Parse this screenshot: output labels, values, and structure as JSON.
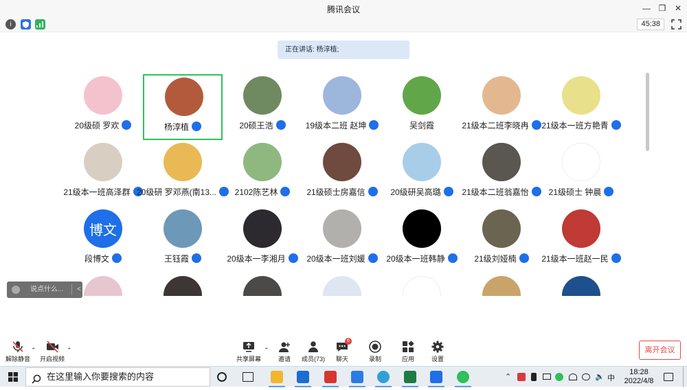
{
  "window": {
    "title": "腾讯会议",
    "timer": "45:38",
    "speaking": "正在讲话: 杨淳植;"
  },
  "participants": [
    {
      "name": "20级硕 罗欢",
      "color": "#f4c2cc",
      "active": false
    },
    {
      "name": "杨淳植",
      "color": "#b45a3c",
      "active": true
    },
    {
      "name": "20硕王浩",
      "color": "#6f8a61",
      "active": false
    },
    {
      "name": "19级本二班 赵坤",
      "color": "#9db6dc",
      "active": false
    },
    {
      "name": "吴剑霞",
      "color": "#62a64a",
      "active": false
    },
    {
      "name": "21级本二班李晓冉",
      "color": "#e3b890",
      "active": false
    },
    {
      "name": "21级本一班方艳青",
      "color": "#e8e08a",
      "active": false
    },
    {
      "name": "21级本一班高泽群",
      "color": "#d8cfc2",
      "active": false
    },
    {
      "name": "20级研 罗邓燕(南13...",
      "color": "#e9b955",
      "active": false
    },
    {
      "name": "2102陈艺林",
      "color": "#8fb880",
      "active": false
    },
    {
      "name": "21级硕士房嘉信",
      "color": "#6e4b3e",
      "active": false
    },
    {
      "name": "20级研吴高璐",
      "color": "#a8cde8",
      "active": false
    },
    {
      "name": "21级本二班翁嘉怡",
      "color": "#5a5650",
      "active": false
    },
    {
      "name": "21级硕士 钟晨",
      "color": "#ffffff",
      "active": false
    },
    {
      "name": "段博文",
      "color": "#1e6fe8",
      "text": "博文",
      "active": false
    },
    {
      "name": "王钰霞",
      "color": "#6e98b8",
      "active": false
    },
    {
      "name": "20级本一李湘月",
      "color": "#2c2a2e",
      "active": false
    },
    {
      "name": "20级本一班刘媛",
      "color": "#b2b0ac",
      "active": false
    },
    {
      "name": "20级本一班韩静",
      "color": "#000000",
      "active": false
    },
    {
      "name": "21级刘娅楠",
      "color": "#6b6450",
      "active": false
    },
    {
      "name": "21级本一班赵一民",
      "color": "#c03a36",
      "active": false
    },
    {
      "name": "",
      "color": "#e7c6d0",
      "active": false
    },
    {
      "name": "",
      "color": "#3c3734",
      "active": false
    },
    {
      "name": "",
      "color": "#4c4a48",
      "active": false
    },
    {
      "name": "",
      "color": "#dfe6f2",
      "active": false
    },
    {
      "name": "",
      "color": "#ffffff",
      "active": false
    },
    {
      "name": "",
      "color": "#c9a46a",
      "active": false
    },
    {
      "name": "",
      "color": "#1f4f8c",
      "active": false
    }
  ],
  "chat": {
    "placeholder": "说点什么...",
    "collapse": "<"
  },
  "controls": {
    "mute": "解除静音",
    "video": "开启视频",
    "share": "共享屏幕",
    "invite": "邀请",
    "members": "成员(73)",
    "chat": "聊天",
    "chat_badge": "6",
    "record": "录制",
    "apps": "应用",
    "settings": "设置",
    "leave": "离开会议"
  },
  "taskbar": {
    "search_placeholder": "在这里输入你要搜索的内容",
    "ime": "中",
    "time": "18:28",
    "date": "2022/4/8"
  },
  "colors": {
    "accent": "#1e6fe8",
    "active_border": "#2dc35c",
    "leave": "#e64646"
  }
}
